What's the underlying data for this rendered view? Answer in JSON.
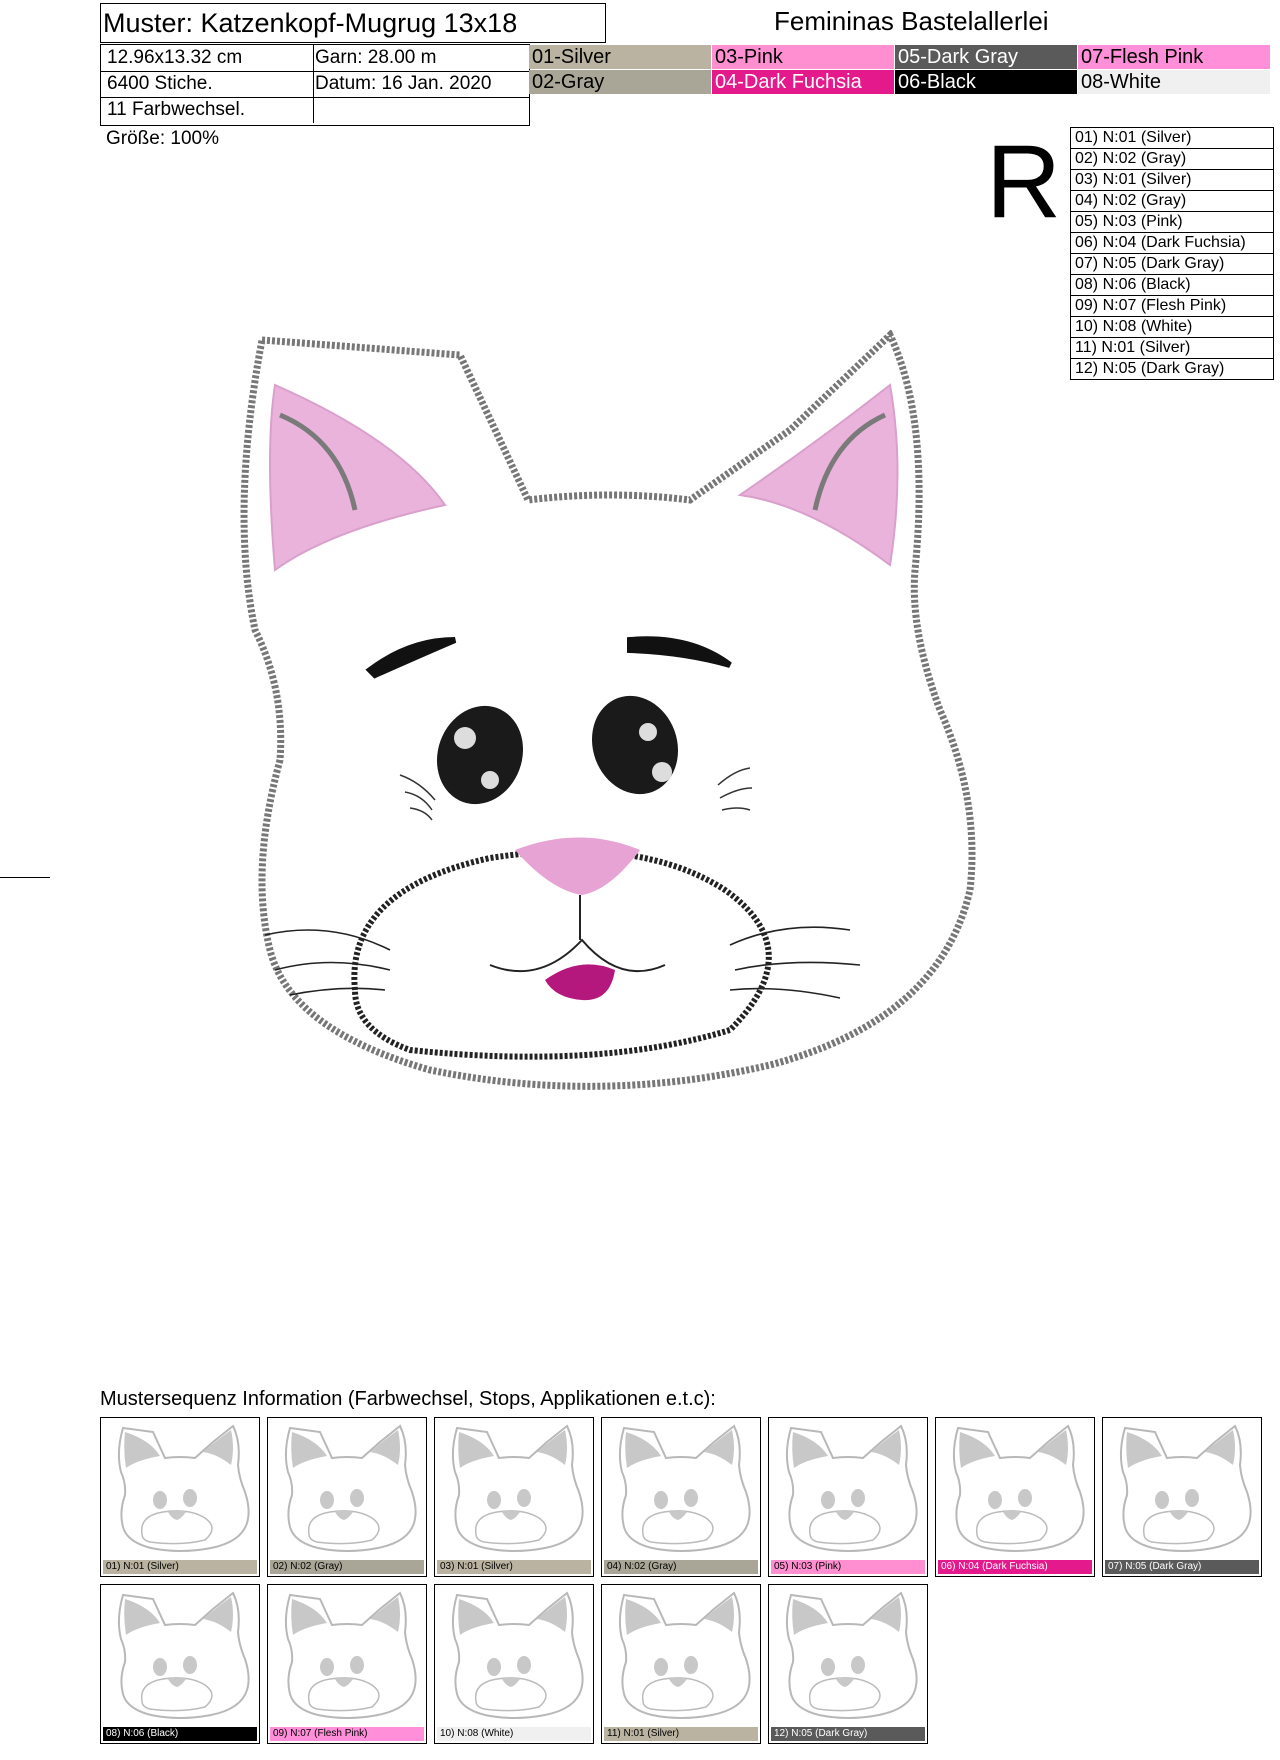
{
  "header": {
    "title": "Muster: Katzenkopf-Mugrug 13x18",
    "brand": "Femininas Bastelallerlei",
    "info": {
      "size": "12.96x13.32 cm",
      "garn": "Garn: 28.00 m",
      "stiche": "6400 Stiche.",
      "datum": "Datum: 16 Jan. 2020",
      "farbwechsel": "11 Farbwechsel."
    },
    "groesse": "Größe: 100%",
    "r_mark": "R"
  },
  "palette": [
    {
      "label": "01-Silver",
      "bg": "#bab3a1",
      "fg": "#000000"
    },
    {
      "label": "03-Pink",
      "bg": "#ff8fd0",
      "fg": "#000000"
    },
    {
      "label": "05-Dark Gray",
      "bg": "#5a5a5a",
      "fg": "#ffffff"
    },
    {
      "label": "07-Flesh Pink",
      "bg": "#ff8fd8",
      "fg": "#000000"
    },
    {
      "label": "02-Gray",
      "bg": "#a9a697",
      "fg": "#000000"
    },
    {
      "label": "04-Dark Fuchsia",
      "bg": "#e4198b",
      "fg": "#ffffff"
    },
    {
      "label": "06-Black",
      "bg": "#000000",
      "fg": "#ffffff"
    },
    {
      "label": "08-White",
      "bg": "#f0f0f0",
      "fg": "#000000"
    }
  ],
  "steps": [
    "01) N:01 (Silver)",
    "02) N:02 (Gray)",
    "03) N:01 (Silver)",
    "04) N:02 (Gray)",
    "05) N:03 (Pink)",
    "06) N:04 (Dark Fuchsia)",
    "07) N:05 (Dark Gray)",
    "08) N:06 (Black)",
    "09) N:07 (Flesh Pink)",
    "10) N:08 (White)",
    "11) N:01 (Silver)",
    "12) N:05 (Dark Gray)"
  ],
  "sequence": {
    "title": "Mustersequenz Information (Farbwechsel, Stops, Applikationen e.t.c):",
    "thumbs": [
      {
        "label": "01) N:01 (Silver)",
        "bg": "#bab3a1",
        "fg": "#000000"
      },
      {
        "label": "02) N:02 (Gray)",
        "bg": "#a9a697",
        "fg": "#000000"
      },
      {
        "label": "03) N:01 (Silver)",
        "bg": "#bab3a1",
        "fg": "#000000"
      },
      {
        "label": "04) N:02 (Gray)",
        "bg": "#a9a697",
        "fg": "#000000"
      },
      {
        "label": "05) N:03 (Pink)",
        "bg": "#ff8fd0",
        "fg": "#000000"
      },
      {
        "label": "06) N:04 (Dark Fuchsia)",
        "bg": "#e4198b",
        "fg": "#ffffff"
      },
      {
        "label": "07) N:05 (Dark Gray)",
        "bg": "#5a5a5a",
        "fg": "#ffffff"
      },
      {
        "label": "08) N:06 (Black)",
        "bg": "#000000",
        "fg": "#ffffff"
      },
      {
        "label": "09) N:07 (Flesh Pink)",
        "bg": "#ff8fd8",
        "fg": "#000000"
      },
      {
        "label": "10) N:08 (White)",
        "bg": "#f0f0f0",
        "fg": "#000000"
      },
      {
        "label": "11) N:01 (Silver)",
        "bg": "#bab3a1",
        "fg": "#000000"
      },
      {
        "label": "12) N:05 (Dark Gray)",
        "bg": "#5a5a5a",
        "fg": "#ffffff"
      }
    ]
  }
}
